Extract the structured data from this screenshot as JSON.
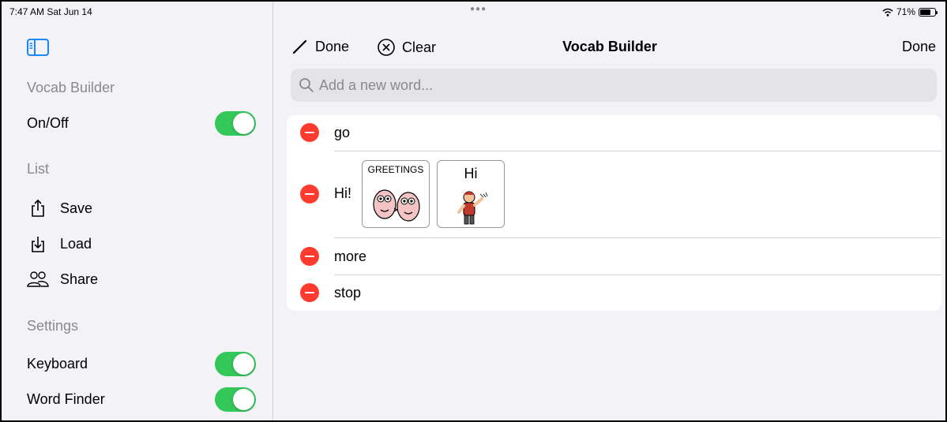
{
  "status_bar": {
    "time": "7:47 AM  Sat Jun 14",
    "battery": "71%",
    "battery_level": 0.71
  },
  "sidebar": {
    "section_vocab": "Vocab Builder",
    "on_off": {
      "label": "On/Off",
      "on": true
    },
    "section_list": "List",
    "save": "Save",
    "load": "Load",
    "share": "Share",
    "section_settings": "Settings",
    "keyboard": {
      "label": "Keyboard",
      "on": true
    },
    "word_finder": {
      "label": "Word Finder",
      "on": true
    }
  },
  "toolbar": {
    "done_edit": "Done",
    "clear": "Clear",
    "title": "Vocab Builder",
    "done": "Done"
  },
  "search": {
    "placeholder": "Add a new word..."
  },
  "words": [
    {
      "text": "go"
    },
    {
      "text": "Hi!",
      "symbols": [
        "GREETINGS",
        "Hi"
      ]
    },
    {
      "text": "more"
    },
    {
      "text": "stop"
    }
  ],
  "colors": {
    "toggle_on": "#34c759",
    "delete": "#ff3b30",
    "accent": "#000000"
  }
}
